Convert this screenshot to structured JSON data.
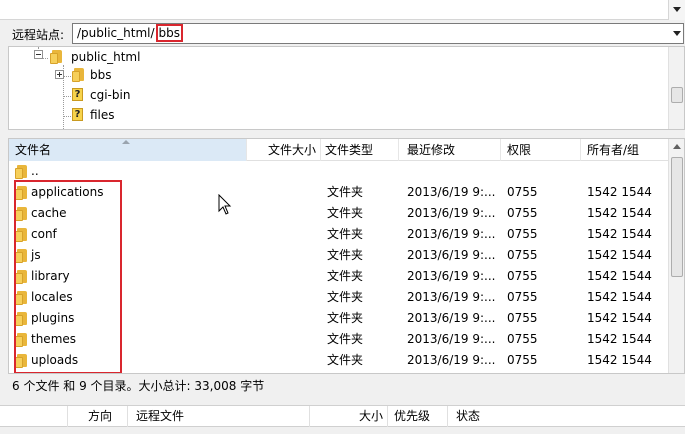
{
  "site_bar": {
    "label": "远程站点:",
    "path_prefix": "/public_html/",
    "path_highlight": "bbs"
  },
  "tree": {
    "items": [
      {
        "label": "public_html",
        "icon": "folder-icon"
      },
      {
        "label": "bbs",
        "icon": "folder-icon"
      },
      {
        "label": "cgi-bin",
        "icon": "unknown-folder-icon"
      },
      {
        "label": "files",
        "icon": "unknown-folder-icon"
      }
    ]
  },
  "file_list": {
    "columns": [
      "文件名",
      "文件大小",
      "文件类型",
      "最近修改",
      "权限",
      "所有者/组"
    ],
    "parent_row": "..",
    "rows": [
      {
        "name": "applications",
        "type": "文件夹",
        "modified": "2013/6/19 9:...",
        "perm": "0755",
        "owner": "1542 1544"
      },
      {
        "name": "cache",
        "type": "文件夹",
        "modified": "2013/6/19 9:...",
        "perm": "0755",
        "owner": "1542 1544"
      },
      {
        "name": "conf",
        "type": "文件夹",
        "modified": "2013/6/19 9:...",
        "perm": "0755",
        "owner": "1542 1544"
      },
      {
        "name": "js",
        "type": "文件夹",
        "modified": "2013/6/19 9:...",
        "perm": "0755",
        "owner": "1542 1544"
      },
      {
        "name": "library",
        "type": "文件夹",
        "modified": "2013/6/19 9:...",
        "perm": "0755",
        "owner": "1542 1544"
      },
      {
        "name": "locales",
        "type": "文件夹",
        "modified": "2013/6/19 9:...",
        "perm": "0755",
        "owner": "1542 1544"
      },
      {
        "name": "plugins",
        "type": "文件夹",
        "modified": "2013/6/19 9:...",
        "perm": "0755",
        "owner": "1542 1544"
      },
      {
        "name": "themes",
        "type": "文件夹",
        "modified": "2013/6/19 9:...",
        "perm": "0755",
        "owner": "1542 1544"
      },
      {
        "name": "uploads",
        "type": "文件夹",
        "modified": "2013/6/19 9:...",
        "perm": "0755",
        "owner": "1542 1544"
      }
    ]
  },
  "status": "6 个文件 和 9 个目录。大小总计: 33,008 字节",
  "queue": {
    "columns": [
      "方向",
      "远程文件",
      "大小",
      "优先级",
      "状态"
    ]
  },
  "colors": {
    "highlight_red": "#d9262e",
    "header_selected": "#dbe9f6",
    "folder_yellow": "#f6cf5a"
  }
}
